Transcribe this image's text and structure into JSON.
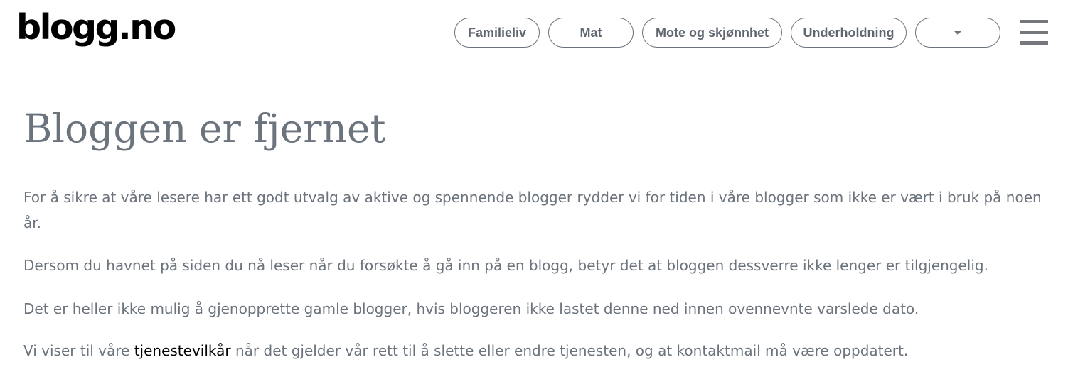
{
  "header": {
    "logo_text": "blogg.no",
    "nav": {
      "familieliv": "Familieliv",
      "mat": "Mat",
      "mote": "Mote og skjønnhet",
      "underholdning": "Underholdning"
    },
    "dropdown_icon": "caret-down-icon",
    "menu_icon": "hamburger-menu-icon"
  },
  "main": {
    "title": "Bloggen er fjernet",
    "p1": "For å sikre at våre lesere har ett godt utvalg av aktive og spennende blogger rydder vi for tiden i våre blogger som ikke er vært i bruk på noen år.",
    "p2": "Dersom du havnet på siden du nå leser når du forsøkte å gå inn på en blogg, betyr det at bloggen dessverre ikke lenger er tilgjengelig.",
    "p3": "Det er heller ikke mulig å gjenopprette gamle blogger, hvis bloggeren ikke lastet denne ned innen ovennevnte varslede dato.",
    "p4_before": "Vi viser til våre ",
    "p4_link": "tjenestevilkår",
    "p4_after": " når det gjelder vår rett til å slette eller endre tjenesten, og at kontaktmail må være oppdatert."
  },
  "colors": {
    "text": "#6b737d",
    "link": "#000000",
    "pill_border": "#6c737d",
    "logo": "#000000"
  }
}
